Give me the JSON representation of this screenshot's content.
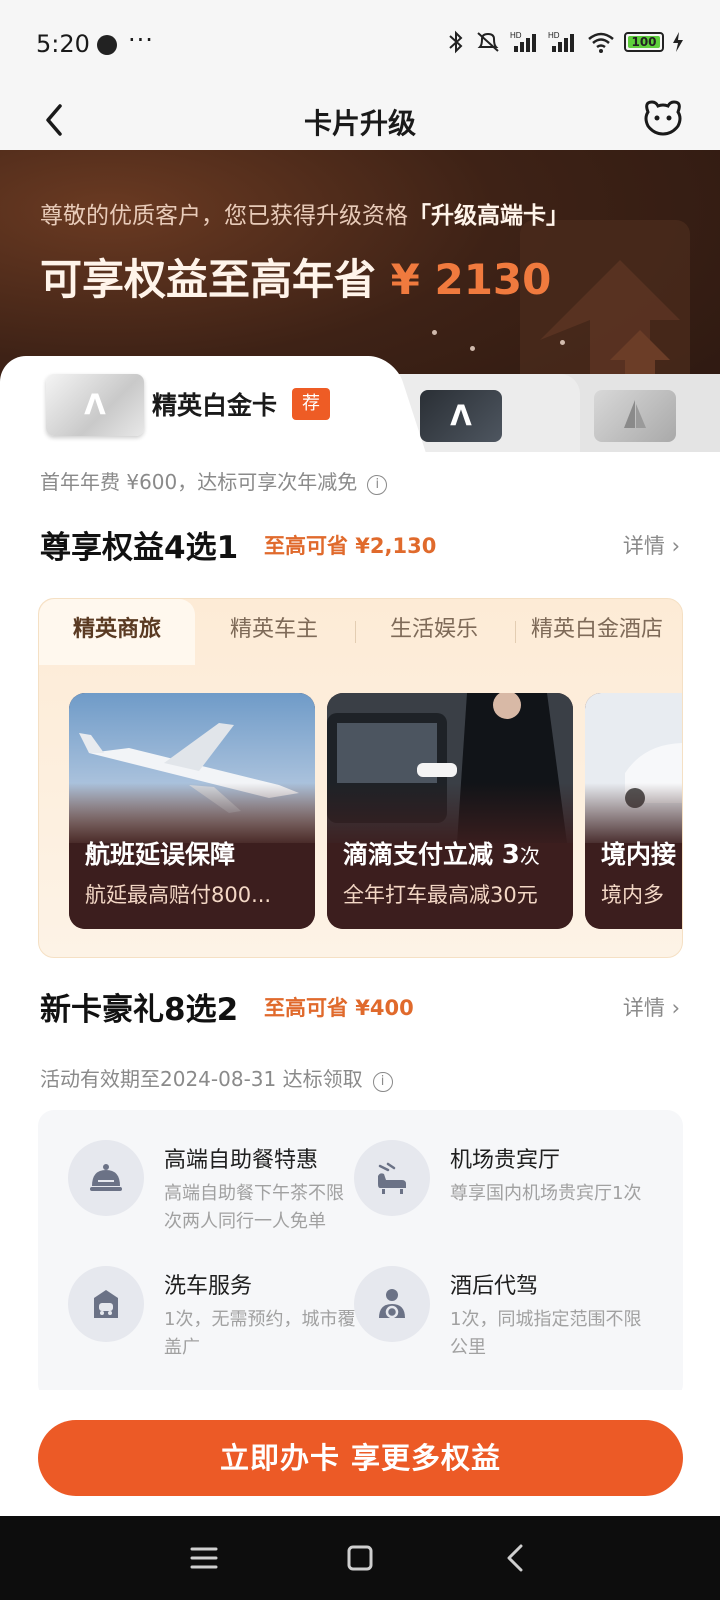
{
  "status_bar": {
    "time": "5:20",
    "more": "···",
    "battery": "100"
  },
  "header": {
    "title": "卡片升级"
  },
  "hero": {
    "line1_prefix": "尊敬的优质客户，您已获得升级资格",
    "line1_highlight": "「升级高端卡」",
    "line2_prefix": "可享权益至高年省",
    "line2_amount": "¥ 2130"
  },
  "cards": {
    "active_name": "精英白金卡",
    "recommend_tag": "荐"
  },
  "fee_note": "首年年费 ¥600，达标可享次年减免",
  "benefits": {
    "title": "尊享权益4选1",
    "save": "至高可省 ¥2,130",
    "detail": "详情 ›",
    "tabs": [
      "精英商旅",
      "精英车主",
      "生活娱乐",
      "精英白金酒店"
    ],
    "items": [
      {
        "title": "航班延误保障",
        "subtitle": "航延最高赔付800..."
      },
      {
        "title": "滴滴支付立减",
        "times": "3",
        "unit": "次",
        "subtitle": "全年打车最高减30元"
      },
      {
        "title": "境内接",
        "subtitle": "境内多"
      }
    ]
  },
  "gifts": {
    "title": "新卡豪礼8选2",
    "save": "至高可省 ¥400",
    "detail": "详情 ›",
    "valid": "活动有效期至2024-08-31   达标领取",
    "items": [
      {
        "name": "高端自助餐特惠",
        "desc": "高端自助餐下午茶不限次两人同行一人免单",
        "icon": "cloche-icon"
      },
      {
        "name": "机场贵宾厅",
        "desc": "尊享国内机场贵宾厅1次",
        "icon": "lounge-chair-icon"
      },
      {
        "name": "洗车服务",
        "desc": "1次，无需预约，城市覆盖广",
        "icon": "car-wash-icon"
      },
      {
        "name": "酒后代驾",
        "desc": "1次，同城指定范围不限公里",
        "icon": "driver-icon"
      }
    ]
  },
  "cta": {
    "label": "立即办卡 享更多权益"
  },
  "colors": {
    "accent": "#ec5a26",
    "hero_bg": "#3e2216",
    "save_text": "#e06a2c"
  }
}
